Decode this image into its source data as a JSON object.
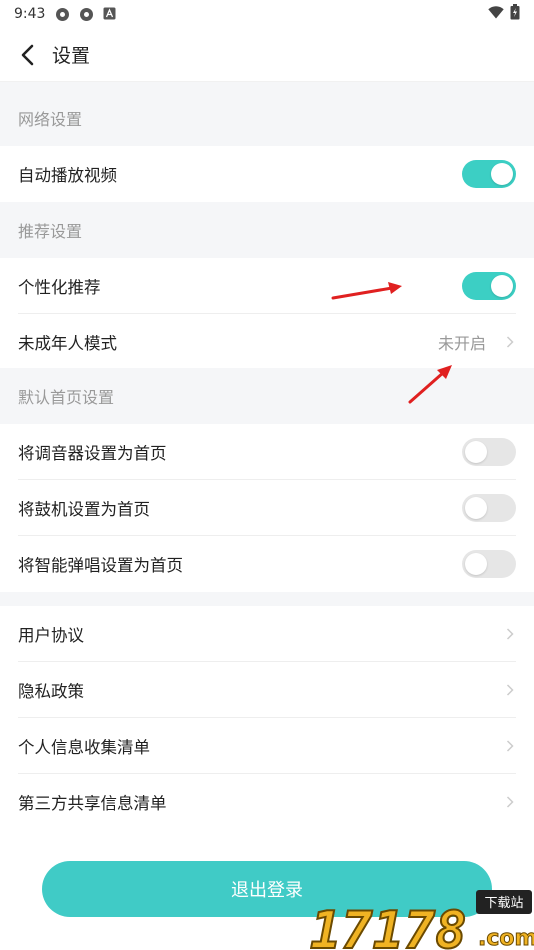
{
  "status_bar": {
    "time": "9:43"
  },
  "header": {
    "title": "设置"
  },
  "sections": {
    "network": {
      "title": "网络设置",
      "autoplay_label": "自动播放视频",
      "autoplay_on": true
    },
    "recommend": {
      "title": "推荐设置",
      "personalized_label": "个性化推荐",
      "personalized_on": true,
      "youth_label": "未成年人模式",
      "youth_value": "未开启"
    },
    "homepage": {
      "title": "默认首页设置",
      "tuner_label": "将调音器设置为首页",
      "tuner_on": false,
      "drum_label": "将鼓机设置为首页",
      "drum_on": false,
      "smart_label": "将智能弹唱设置为首页",
      "smart_on": false
    },
    "legal": {
      "user_agreement": "用户协议",
      "privacy_policy": "隐私政策",
      "personal_info_list": "个人信息收集清单",
      "third_party_list": "第三方共享信息清单"
    }
  },
  "logout_button": "退出登录",
  "watermark": {
    "number": "17178",
    "domain": ".com",
    "tag": "下载站"
  },
  "colors": {
    "accent": "#3ccfc4",
    "toggle_off": "#e6e6e6",
    "section_bg": "#f5f6f8",
    "arrow": "#e02020"
  }
}
